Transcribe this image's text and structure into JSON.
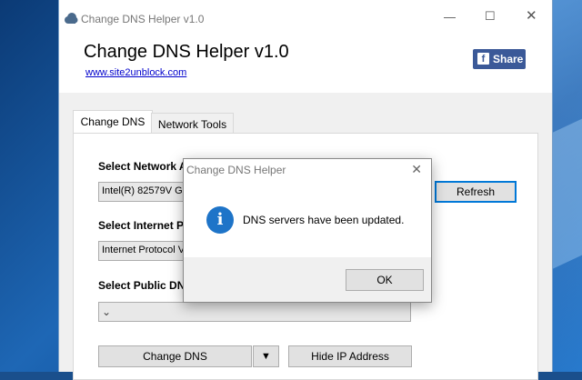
{
  "window": {
    "title": "Change DNS Helper v1.0"
  },
  "header": {
    "app_title": "Change DNS Helper v1.0",
    "site_link": "www.site2unblock.com",
    "share_label": "Share"
  },
  "tabs": [
    {
      "label": "Change DNS",
      "active": true
    },
    {
      "label": "Network Tools",
      "active": false
    }
  ],
  "panel": {
    "network_adapter": {
      "label": "Select Network A",
      "value": "Intel(R) 82579V Gig",
      "refresh_label": "Refresh"
    },
    "internet_protocol": {
      "label": "Select Internet P",
      "value": "Internet Protocol V"
    },
    "public_dns": {
      "label": "Select Public DNS",
      "value": ""
    },
    "change_dns_label": "Change DNS",
    "hide_ip_label": "Hide IP Address"
  },
  "dialog": {
    "title": "Change DNS Helper",
    "message": "DNS servers have been updated.",
    "ok_label": "OK"
  },
  "colors": {
    "accent": "#0078d7",
    "facebook": "#3b5998",
    "info_icon": "#1e74c8"
  }
}
